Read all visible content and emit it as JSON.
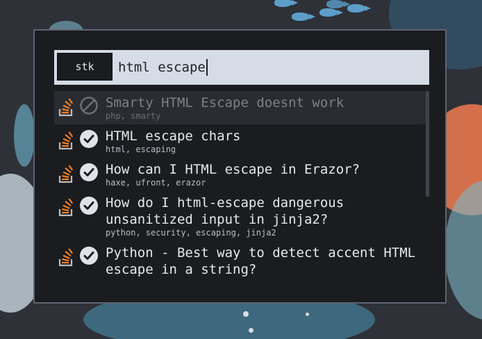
{
  "launcher": {
    "mode_label": "stk",
    "query": "html escape"
  },
  "results": [
    {
      "title": "Smarty HTML Escape doesnt work",
      "tags": "php, smarty",
      "status": "unanswered",
      "selected": true
    },
    {
      "title": "HTML escape chars",
      "tags": "html, escaping",
      "status": "answered"
    },
    {
      "title": "How can I HTML escape in Erazor?",
      "tags": "haxe, ufront, erazor",
      "status": "answered"
    },
    {
      "title": "How do I html-escape dangerous unsanitized input in jinja2?",
      "tags": "python, security, escaping, jinja2",
      "status": "answered"
    },
    {
      "title": "Python - Best way to detect accent HTML escape in a string?",
      "tags": "",
      "status": "answered"
    }
  ],
  "icons": {
    "source": "stackoverflow-icon",
    "answered": "check-circle-icon",
    "unanswered": "prohibited-icon"
  },
  "colors": {
    "launcher_bg": "#1b1c1f",
    "search_bg": "#d5dce6",
    "stackoverflow_orange": "#f48024",
    "check_circle": "#dfe3e8"
  }
}
